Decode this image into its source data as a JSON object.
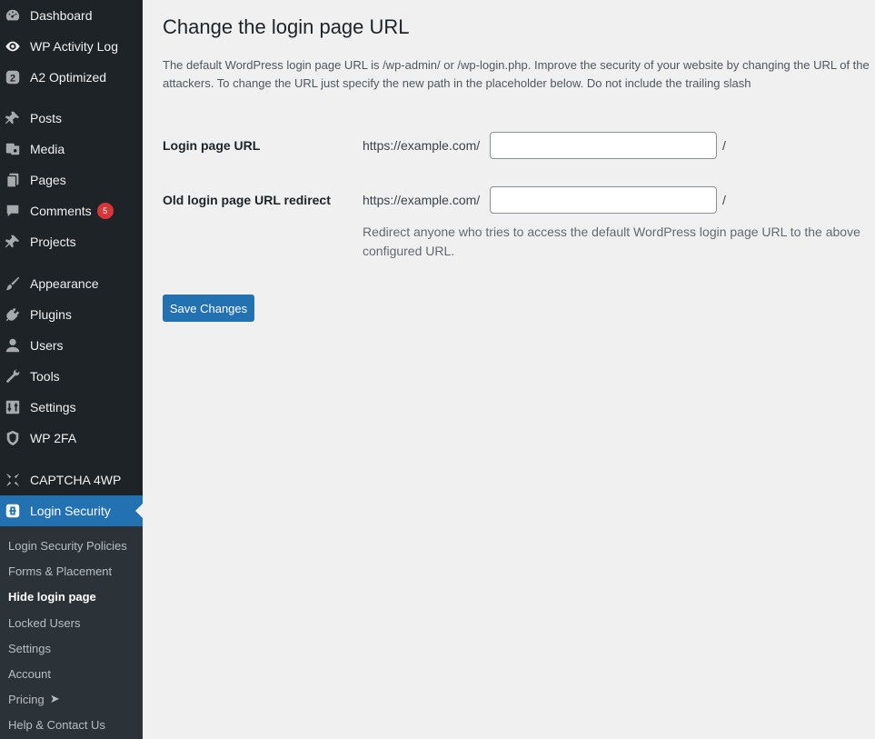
{
  "sidebar": {
    "items": [
      {
        "label": "Dashboard",
        "icon": "dashboard-icon"
      },
      {
        "label": "WP Activity Log",
        "icon": "eye-icon"
      },
      {
        "label": "A2 Optimized",
        "icon": "a2-logo-icon"
      },
      {
        "label": "Posts",
        "icon": "pin-icon"
      },
      {
        "label": "Media",
        "icon": "media-icon"
      },
      {
        "label": "Pages",
        "icon": "pages-icon"
      },
      {
        "label": "Comments",
        "icon": "comment-icon",
        "badge": "5"
      },
      {
        "label": "Projects",
        "icon": "pin-icon"
      },
      {
        "label": "Appearance",
        "icon": "brush-icon"
      },
      {
        "label": "Plugins",
        "icon": "plugin-icon"
      },
      {
        "label": "Users",
        "icon": "user-icon"
      },
      {
        "label": "Tools",
        "icon": "wrench-icon"
      },
      {
        "label": "Settings",
        "icon": "settings-icon"
      },
      {
        "label": "WP 2FA",
        "icon": "shield-icon"
      },
      {
        "label": "CAPTCHA 4WP",
        "icon": "captcha-icon"
      },
      {
        "label": "Login Security",
        "icon": "login-security-icon",
        "current": true
      }
    ],
    "submenu": [
      {
        "label": "Login Security Policies"
      },
      {
        "label": "Forms & Placement"
      },
      {
        "label": "Hide login page",
        "active": true
      },
      {
        "label": "Locked Users"
      },
      {
        "label": "Settings"
      },
      {
        "label": "Account"
      },
      {
        "label": "Pricing",
        "arrow": "➤"
      },
      {
        "label": "Help & Contact Us"
      }
    ]
  },
  "main": {
    "title": "Change the login page URL",
    "description_line1": "The default WordPress login page URL is /wp-admin/ or /wp-login.php. Improve the security of your website by changing the URL of the",
    "description_line2": "attackers. To change the URL just specify the new path in the placeholder below. Do not include the trailing slash",
    "login_url": {
      "label": "Login page URL",
      "prefix": "https://example.com/",
      "value": "",
      "suffix": "/"
    },
    "old_redirect": {
      "label": "Old login page URL redirect",
      "prefix": "https://example.com/",
      "value": "",
      "suffix": "/",
      "help": "Redirect anyone who tries to access the default WordPress login page URL to the above configured URL."
    },
    "save_label": "Save Changes"
  },
  "colors": {
    "sidebar_bg": "#1d2327",
    "submenu_bg": "#2c3338",
    "accent": "#2271b1",
    "badge": "#d63638",
    "page_bg": "#f0f0f1"
  }
}
